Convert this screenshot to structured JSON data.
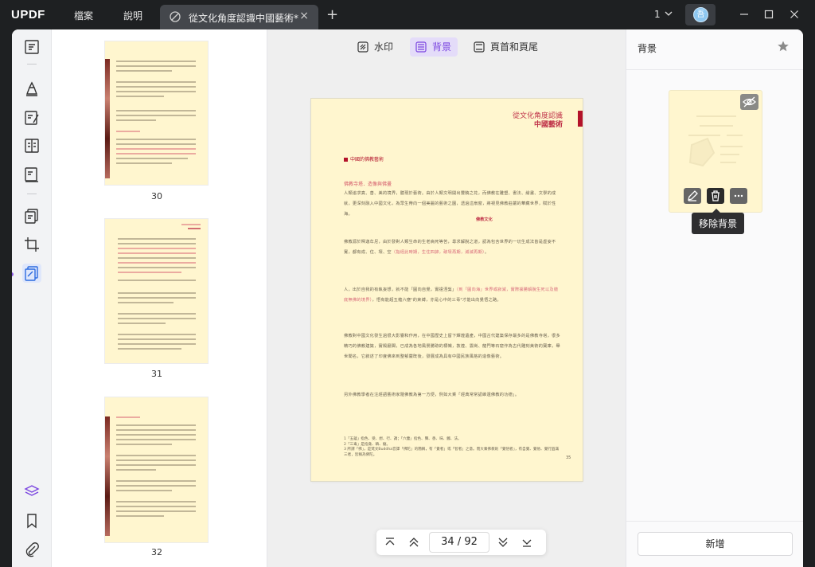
{
  "app": {
    "logo": "UPDF",
    "menu": [
      "檔案",
      "說明"
    ],
    "tab_title": "從文化角度認識中國藝術*",
    "tab_close": "×",
    "tab_add": "+",
    "window_count": "1",
    "avatar_initial": "吾"
  },
  "thumbnails": [
    {
      "page": "30"
    },
    {
      "page": "31"
    },
    {
      "page": "32"
    }
  ],
  "actions": {
    "watermark": "水印",
    "background": "背景",
    "header_footer": "頁首和頁尾"
  },
  "document": {
    "header_line1": "從文化角度認識",
    "header_line2": "中國藝術",
    "section_title": "中國的佛教藝術",
    "sub_title": "佛教寺塔．造像與佛畫",
    "para1": "人類追求真、善、美的境界，體現於藝術。由於人類文明開出豐饒之花，而佛教在雕塑、書法、繪畫、文學的成就，更深刻融入中國文化，為眾生帶向一個美麗的藝術之園，透過這扇窗，將視見佛教莊嚴的華藏世界，賦於性海。",
    "para1_tag": "佛教文化",
    "para2_a": "佛教源於釋迦牟尼，由於發對人類生命的生老病死等苦，尋求解脫之道，認為包含世界的一切生成法皆是虛妄不實，都有成、住、壞、空",
    "para2_hl": "（指經此時期，生住四諦，破壞再期，滅滅再期）",
    "para2_b": "。",
    "para3_a": "人，出於自我的有執妄想，就不能「圓向自覺，實證涅槃」",
    "para3_hl": "（到「圓向海」世界或寂滅，實際據勝解脫生死以及徹底無佛的境界）",
    "para3_b": "，悟有能超五蘊六塵¹的束縛，亦是心中的三毒²才能出向覺悟之路。",
    "para4": "佛教對中國文化發生過很大影響和作用，在中國歷史上留下輝煌遺產，中國古代建築保存最多的是佛教寺塔，很多精巧的佛教建築，實殿廳閣，已成為各地風景勝跡的標幟，敦煌、雲崗、龍門等石窟作為古代雕刻美術的寶庫，舉世聞名，它敘述了印度佛來到整郁嚴既後，發展成為具有中國民族風格的造像藝術。",
    "para5": "另外佛教學者在注經語藝術家隨佛教為第一方便，例如大乘「經典常常認維還佛教的功德」。",
    "note1": "1「五蘊」指色、受、想、行、識；「六塵」指色、聲、香、味、觸、法。",
    "note2": "2「三毒」是指貪、瞋、癡。",
    "note3": "3 所謂「佛」，是梵文Buddha音譯「佛陀」的簡稱，有「覺者」或「智者」之意。而大乘佛教則「覺悟者」，有自覺、覺他、覺行圓滿三者，皆稱為佛陀。",
    "page_number": "35"
  },
  "nav": {
    "current": "34",
    "separator": "/",
    "total": "92"
  },
  "panel": {
    "title": "背景",
    "tooltip": "移除背景",
    "add_button": "新增"
  },
  "colors": {
    "accent": "#7a44e0",
    "page_bg": "#fff6cf",
    "header_red": "#b3122a"
  }
}
